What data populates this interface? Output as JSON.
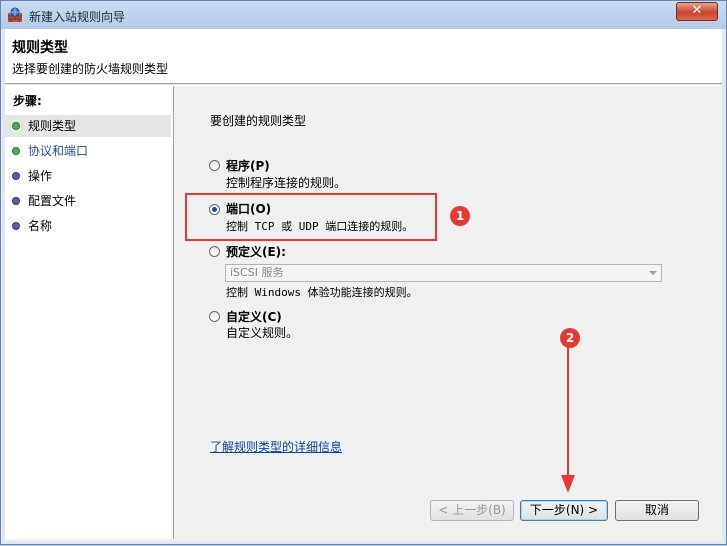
{
  "window": {
    "title": "新建入站规则向导",
    "close_label": "✕"
  },
  "header": {
    "title": "规则类型",
    "subtitle": "选择要创建的防火墙规则类型"
  },
  "steps": {
    "title": "步骤:",
    "items": [
      {
        "label": "规则类型",
        "status": "done",
        "color": "green"
      },
      {
        "label": "协议和端口",
        "status": "pending",
        "color": "green"
      },
      {
        "label": "操作",
        "status": "pending",
        "color": "purple"
      },
      {
        "label": "配置文件",
        "status": "pending",
        "color": "purple"
      },
      {
        "label": "名称",
        "status": "pending",
        "color": "purple"
      }
    ]
  },
  "main": {
    "prompt": "要创建的规则类型",
    "options": [
      {
        "title": "程序(P)",
        "desc": "控制程序连接的规则。",
        "checked": false
      },
      {
        "title": "端口(O)",
        "desc": "控制 TCP 或 UDP 端口连接的规则。",
        "checked": true
      },
      {
        "title": "预定义(E):",
        "desc": "控制 Windows 体验功能连接的规则。",
        "checked": false,
        "select_value": "iSCSI 服务"
      },
      {
        "title": "自定义(C)",
        "desc": "自定义规则。",
        "checked": false
      }
    ],
    "link": "了解规则类型的详细信息"
  },
  "buttons": {
    "back": "< 上一步(B)",
    "next": "下一步(N) >",
    "cancel": "取消"
  },
  "annotations": {
    "badge1": "1",
    "badge2": "2",
    "color": "#e53935"
  }
}
